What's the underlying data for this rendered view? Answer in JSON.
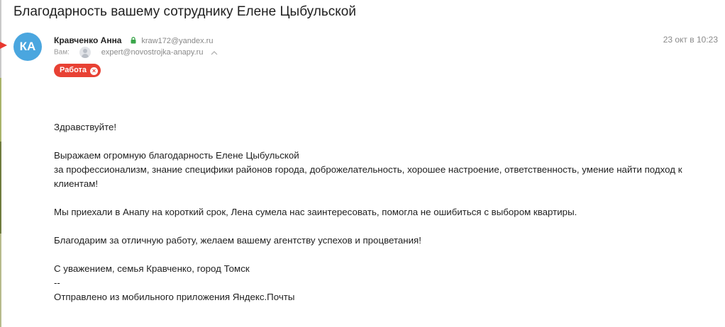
{
  "email": {
    "subject": "Благодарность вашему сотруднику Елене Цыбульской",
    "sender": {
      "initials": "КА",
      "name": "Кравченко Анна",
      "email": "kraw172@yandex.ru",
      "avatar_color": "#4aa6df"
    },
    "date": "23 окт в 10:23",
    "to": {
      "label": "Вам:",
      "email": "expert@novostrojka-anapy.ru"
    },
    "label": {
      "text": "Работа",
      "color": "#e84134"
    },
    "body": {
      "greeting": "Здравствуйте!",
      "line1": "Выражаем огромную благодарность Елене Цыбульской",
      "line2": "за профессионализм, знание специфики районов города, доброжелательность, хорошее настроение, ответственность, умение найти подход к",
      "line3": "клиентам!",
      "line4": "Мы приехали в Анапу на короткий срок, Лена сумела нас заинтересовать, помогла не ошибиться с выбором квартиры.",
      "line5": "Благодарим за отличную работу, желаем вашему агентству успехов  и процветания!",
      "signature": "С уважением, семья Кравченко, город Томск",
      "separator": "--",
      "footer": "Отправлено из мобильного приложения Яндекс.Почты"
    }
  }
}
